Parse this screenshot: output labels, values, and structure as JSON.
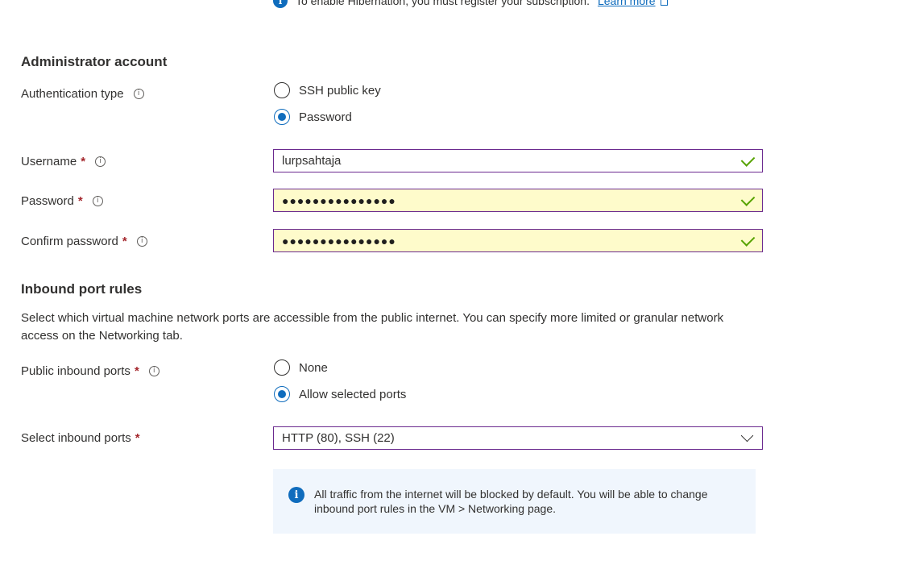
{
  "top_notice": {
    "text": "To enable Hibernation, you must register your subscription.",
    "link": "Learn more",
    "icon": "info-icon",
    "external_icon": "external-link-icon"
  },
  "admin": {
    "title": "Administrator account",
    "auth_type": {
      "label": "Authentication type",
      "options": [
        {
          "label": "SSH public key",
          "checked": false
        },
        {
          "label": "Password",
          "checked": true
        }
      ]
    },
    "username": {
      "label": "Username",
      "required": "*",
      "value": "lurpsahtaja"
    },
    "password": {
      "label": "Password",
      "required": "*",
      "masked": "●●●●●●●●●●●●●●●"
    },
    "confirm_password": {
      "label": "Confirm password",
      "required": "*",
      "masked": "●●●●●●●●●●●●●●●"
    }
  },
  "inbound": {
    "title": "Inbound port rules",
    "description": "Select which virtual machine network ports are accessible from the public internet. You can specify more limited or granular network access on the Networking tab.",
    "public_ports": {
      "label": "Public inbound ports",
      "required": "*",
      "options": [
        {
          "label": "None",
          "checked": false
        },
        {
          "label": "Allow selected ports",
          "checked": true
        }
      ]
    },
    "select_ports": {
      "label": "Select inbound ports",
      "required": "*",
      "value": "HTTP (80), SSH (22)"
    },
    "info": "All traffic from the internet will be blocked by default. You will be able to change inbound port rules in the VM > Networking page."
  },
  "colors": {
    "accent": "#0f6cbd",
    "required": "#a4262c",
    "field_border": "#6b2a8f",
    "autofill_bg": "#fefbcb",
    "valid_check": "#57a300",
    "info_bg": "#f0f6fd"
  }
}
